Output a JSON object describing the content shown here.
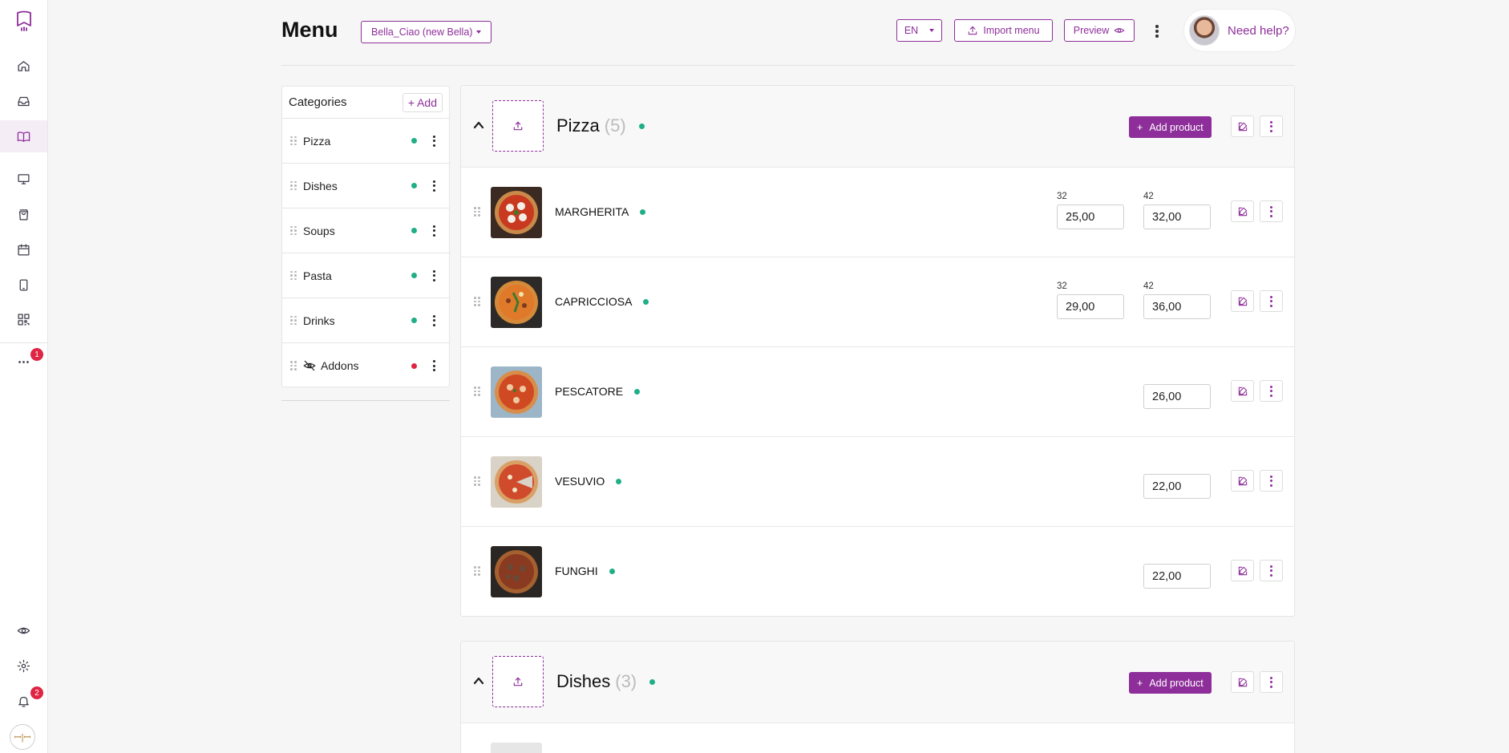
{
  "header": {
    "title": "Menu",
    "venue": "Bella_Ciao (new Bella)",
    "language": "EN",
    "import_label": "Import menu",
    "preview_label": "Preview",
    "help_label": "Need help?"
  },
  "sidebar": {
    "more_badge": "1",
    "notifications_badge": "2",
    "icons": [
      "logo-icon",
      "home-icon",
      "inbox-icon",
      "menu-book-icon",
      "monitor-icon",
      "shopping-bag-icon",
      "calendar-icon",
      "phone-icon",
      "qr-code-icon",
      "more-icon",
      "eye-icon",
      "settings-icon",
      "bell-icon"
    ]
  },
  "categories_panel": {
    "title": "Categories",
    "add_label": "Add",
    "items": [
      {
        "label": "Pizza",
        "status_color": "#1fae86",
        "hidden": false
      },
      {
        "label": "Dishes",
        "status_color": "#1fae86",
        "hidden": false
      },
      {
        "label": "Soups",
        "status_color": "#1fae86",
        "hidden": false
      },
      {
        "label": "Pasta",
        "status_color": "#1fae86",
        "hidden": false
      },
      {
        "label": "Drinks",
        "status_color": "#1fae86",
        "hidden": false
      },
      {
        "label": "Addons",
        "status_color": "#e02443",
        "hidden": true
      }
    ]
  },
  "sections": [
    {
      "name": "Pizza",
      "count": "(5)",
      "add_product_label": "Add product",
      "products": [
        {
          "name": "MARGHERITA",
          "sizes": [
            "32",
            "42"
          ],
          "prices": [
            "25,00",
            "32,00"
          ]
        },
        {
          "name": "CAPRICCIOSA",
          "sizes": [
            "32",
            "42"
          ],
          "prices": [
            "29,00",
            "36,00"
          ]
        },
        {
          "name": "PESCATORE",
          "sizes": [],
          "prices": [
            "26,00"
          ]
        },
        {
          "name": "VESUVIO",
          "sizes": [],
          "prices": [
            "22,00"
          ]
        },
        {
          "name": "FUNGHI",
          "sizes": [],
          "prices": [
            "22,00"
          ]
        }
      ]
    },
    {
      "name": "Dishes",
      "count": "(3)",
      "add_product_label": "Add product",
      "products": []
    }
  ],
  "colors": {
    "accent": "#8e2e9a",
    "active_status": "#1fae86",
    "inactive_status": "#e02443"
  }
}
